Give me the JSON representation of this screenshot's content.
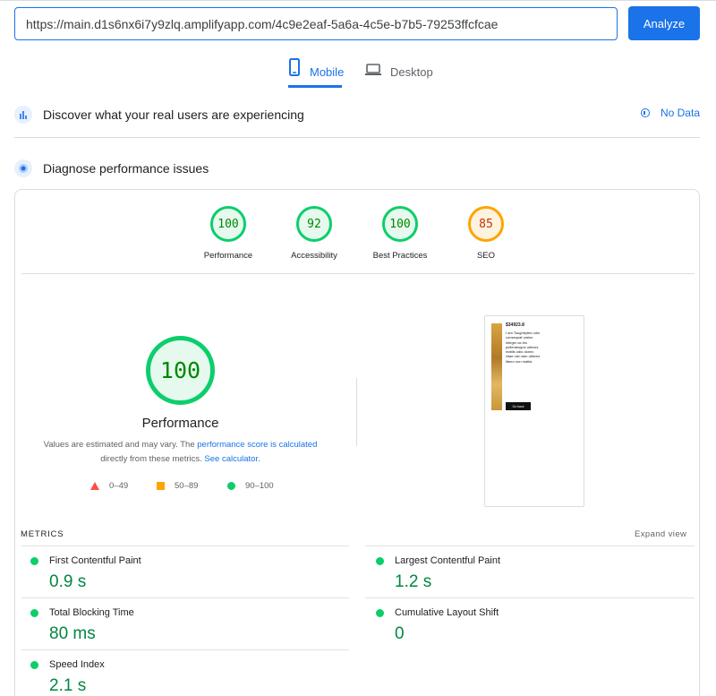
{
  "search": {
    "url": "https://main.d1s6nx6i7y9zlq.amplifyapp.com/4c9e2eaf-5a6a-4c5e-b7b5-79253ffcfcae",
    "analyze_label": "Analyze"
  },
  "tabs": [
    {
      "label": "Mobile",
      "icon": "smartphone-icon",
      "active": true
    },
    {
      "label": "Desktop",
      "icon": "laptop-icon",
      "active": false
    }
  ],
  "discover": {
    "title": "Discover what your real users are experiencing",
    "no_data": "No Data"
  },
  "diagnose": {
    "title": "Diagnose performance issues"
  },
  "scores": [
    {
      "label": "Performance",
      "value": "100"
    },
    {
      "label": "Accessibility",
      "value": "92"
    },
    {
      "label": "Best Practices",
      "value": "100"
    },
    {
      "label": "SEO",
      "value": "85"
    }
  ],
  "performance": {
    "score": "100",
    "label": "Performance",
    "explain_prefix": "Values are estimated and may vary. The ",
    "explain_link": "performance score is calculated",
    "explain_mid": " directly from these metrics. ",
    "explain_link2": "See calculator",
    "explain_suffix": "."
  },
  "legend": {
    "poor": "0–49",
    "average": "50–89",
    "good": "90–100"
  },
  "colors": {
    "accent": "#1a73e8",
    "good": "#0cce6b",
    "average": "#ffa400",
    "poor": "#ff4e42"
  },
  "screenshot": {
    "title": "$34923.8",
    "text": "I am Toughbytes odio consequat varius integer ac leo pellentesque ultrices mattis odio donec vitae nisi nam ultrices libero non mattis",
    "button": "Go back"
  },
  "metrics": {
    "heading": "METRICS",
    "expand": "Expand view",
    "items": [
      {
        "label": "First Contentful Paint",
        "value": "0.9 s"
      },
      {
        "label": "Largest Contentful Paint",
        "value": "1.2 s"
      },
      {
        "label": "Total Blocking Time",
        "value": "80 ms"
      },
      {
        "label": "Cumulative Layout Shift",
        "value": "0"
      },
      {
        "label": "Speed Index",
        "value": "2.1 s"
      }
    ]
  }
}
